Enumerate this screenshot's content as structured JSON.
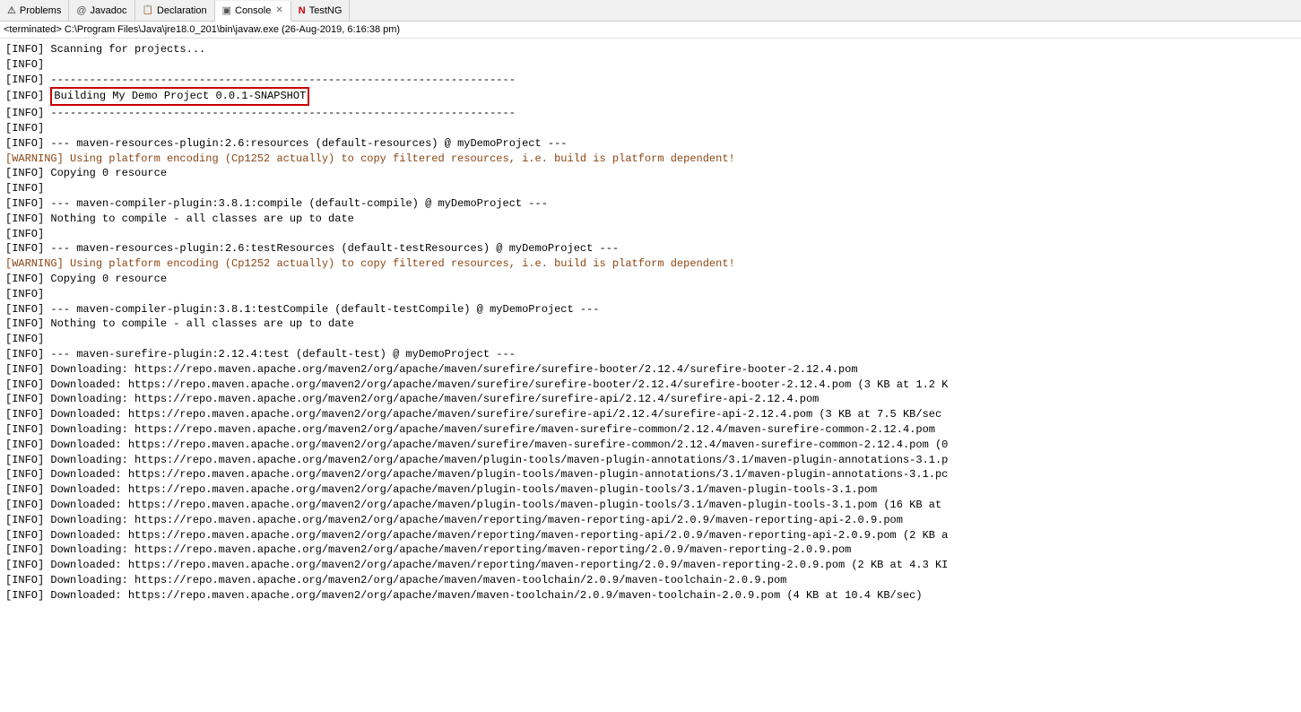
{
  "tabs": [
    {
      "id": "problems",
      "label": "Problems",
      "icon": "⚠",
      "active": false,
      "closeable": false
    },
    {
      "id": "javadoc",
      "label": "Javadoc",
      "icon": "@",
      "active": false,
      "closeable": false
    },
    {
      "id": "declaration",
      "label": "Declaration",
      "icon": "📄",
      "active": false,
      "closeable": false
    },
    {
      "id": "console",
      "label": "Console",
      "icon": "▣",
      "active": true,
      "closeable": true
    },
    {
      "id": "testng",
      "label": "TestNG",
      "icon": "N",
      "active": false,
      "closeable": false
    }
  ],
  "terminated_bar": {
    "text": "<terminated> C:\\Program Files\\Java\\jre18.0_201\\bin\\javaw.exe (26-Aug-2019, 6:16:38 pm)"
  },
  "console_lines": [
    {
      "type": "info",
      "text": "[INFO] Scanning for projects..."
    },
    {
      "type": "info",
      "text": "[INFO]"
    },
    {
      "type": "info",
      "text": "[INFO] ------------------------------------------------------------------------"
    },
    {
      "type": "info",
      "text": "[INFO] Building My Demo Project 0.0.1-SNAPSHOT",
      "highlight": true
    },
    {
      "type": "info",
      "text": "[INFO] ------------------------------------------------------------------------"
    },
    {
      "type": "info",
      "text": "[INFO]"
    },
    {
      "type": "info",
      "text": "[INFO] --- maven-resources-plugin:2.6:resources (default-resources) @ myDemoProject ---"
    },
    {
      "type": "warning",
      "text": "[WARNING] Using platform encoding (Cp1252 actually) to copy filtered resources, i.e. build is platform dependent!"
    },
    {
      "type": "info",
      "text": "[INFO] Copying 0 resource"
    },
    {
      "type": "info",
      "text": "[INFO]"
    },
    {
      "type": "info",
      "text": "[INFO] --- maven-compiler-plugin:3.8.1:compile (default-compile) @ myDemoProject ---"
    },
    {
      "type": "info",
      "text": "[INFO] Nothing to compile - all classes are up to date"
    },
    {
      "type": "info",
      "text": "[INFO]"
    },
    {
      "type": "info",
      "text": "[INFO] --- maven-resources-plugin:2.6:testResources (default-testResources) @ myDemoProject ---"
    },
    {
      "type": "warning",
      "text": "[WARNING] Using platform encoding (Cp1252 actually) to copy filtered resources, i.e. build is platform dependent!"
    },
    {
      "type": "info",
      "text": "[INFO] Copying 0 resource"
    },
    {
      "type": "info",
      "text": "[INFO]"
    },
    {
      "type": "info",
      "text": "[INFO] --- maven-compiler-plugin:3.8.1:testCompile (default-testCompile) @ myDemoProject ---"
    },
    {
      "type": "info",
      "text": "[INFO] Nothing to compile - all classes are up to date"
    },
    {
      "type": "info",
      "text": "[INFO]"
    },
    {
      "type": "info",
      "text": "[INFO] --- maven-surefire-plugin:2.12.4:test (default-test) @ myDemoProject ---"
    },
    {
      "type": "info",
      "text": "[INFO] Downloading: https://repo.maven.apache.org/maven2/org/apache/maven/surefire/surefire-booter/2.12.4/surefire-booter-2.12.4.pom"
    },
    {
      "type": "info",
      "text": "[INFO] Downloaded: https://repo.maven.apache.org/maven2/org/apache/maven/surefire/surefire-booter/2.12.4/surefire-booter-2.12.4.pom (3 KB at 1.2 K"
    },
    {
      "type": "info",
      "text": "[INFO] Downloading: https://repo.maven.apache.org/maven2/org/apache/maven/surefire/surefire-api/2.12.4/surefire-api-2.12.4.pom"
    },
    {
      "type": "info",
      "text": "[INFO] Downloaded: https://repo.maven.apache.org/maven2/org/apache/maven/surefire/surefire-api/2.12.4/surefire-api-2.12.4.pom (3 KB at 7.5 KB/sec"
    },
    {
      "type": "info",
      "text": "[INFO] Downloading: https://repo.maven.apache.org/maven2/org/apache/maven/surefire/maven-surefire-common/2.12.4/maven-surefire-common-2.12.4.pom"
    },
    {
      "type": "info",
      "text": "[INFO] Downloaded: https://repo.maven.apache.org/maven2/org/apache/maven/surefire/maven-surefire-common/2.12.4/maven-surefire-common-2.12.4.pom (0"
    },
    {
      "type": "info",
      "text": "[INFO] Downloading: https://repo.maven.apache.org/maven2/org/apache/maven/plugin-tools/maven-plugin-annotations/3.1/maven-plugin-annotations-3.1.p"
    },
    {
      "type": "info",
      "text": "[INFO] Downloaded: https://repo.maven.apache.org/maven2/org/apache/maven/plugin-tools/maven-plugin-annotations/3.1/maven-plugin-annotations-3.1.pc"
    },
    {
      "type": "info",
      "text": "[INFO] Downloaded: https://repo.maven.apache.org/maven2/org/apache/maven/plugin-tools/maven-plugin-tools/3.1/maven-plugin-tools-3.1.pom"
    },
    {
      "type": "info",
      "text": "[INFO] Downloaded: https://repo.maven.apache.org/maven2/org/apache/maven/plugin-tools/maven-plugin-tools/3.1/maven-plugin-tools-3.1.pom (16 KB at"
    },
    {
      "type": "info",
      "text": "[INFO] Downloading: https://repo.maven.apache.org/maven2/org/apache/maven/reporting/maven-reporting-api/2.0.9/maven-reporting-api-2.0.9.pom"
    },
    {
      "type": "info",
      "text": "[INFO] Downloaded: https://repo.maven.apache.org/maven2/org/apache/maven/reporting/maven-reporting-api/2.0.9/maven-reporting-api-2.0.9.pom (2 KB a"
    },
    {
      "type": "info",
      "text": "[INFO] Downloading: https://repo.maven.apache.org/maven2/org/apache/maven/reporting/maven-reporting/2.0.9/maven-reporting-2.0.9.pom"
    },
    {
      "type": "info",
      "text": "[INFO] Downloaded: https://repo.maven.apache.org/maven2/org/apache/maven/reporting/maven-reporting/2.0.9/maven-reporting-2.0.9.pom (2 KB at 4.3 KI"
    },
    {
      "type": "info",
      "text": "[INFO] Downloading: https://repo.maven.apache.org/maven2/org/apache/maven/maven-toolchain/2.0.9/maven-toolchain-2.0.9.pom"
    },
    {
      "type": "info",
      "text": "[INFO] Downloaded: https://repo.maven.apache.org/maven2/org/apache/maven/maven-toolchain/2.0.9/maven-toolchain-2.0.9.pom (4 KB at 10.4 KB/sec)"
    }
  ]
}
